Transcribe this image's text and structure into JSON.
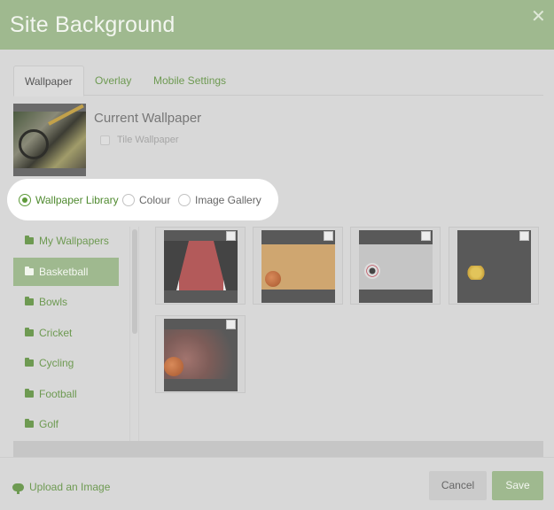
{
  "dialog": {
    "title": "Site Background",
    "close_icon": "close-icon"
  },
  "tabs": [
    {
      "label": "Wallpaper",
      "active": true
    },
    {
      "label": "Overlay",
      "active": false
    },
    {
      "label": "Mobile Settings",
      "active": false
    }
  ],
  "current": {
    "title": "Current Wallpaper",
    "tile_label": "Tile Wallpaper",
    "tile_checked": false
  },
  "source_options": [
    {
      "label": "Wallpaper Library",
      "selected": true
    },
    {
      "label": "Colour",
      "selected": false
    },
    {
      "label": "Image Gallery",
      "selected": false
    }
  ],
  "categories": [
    {
      "label": "My Wallpapers",
      "active": false
    },
    {
      "label": "Basketball",
      "active": true
    },
    {
      "label": "Bowls",
      "active": false
    },
    {
      "label": "Cricket",
      "active": false
    },
    {
      "label": "Cycling",
      "active": false
    },
    {
      "label": "Football",
      "active": false
    },
    {
      "label": "Golf",
      "active": false
    }
  ],
  "footer": {
    "upload_label": "Upload an Image",
    "cancel_label": "Cancel",
    "save_label": "Save"
  },
  "colors": {
    "header": "#9fb98f",
    "accent": "#6e9a52",
    "background": "#d8d8d8"
  }
}
